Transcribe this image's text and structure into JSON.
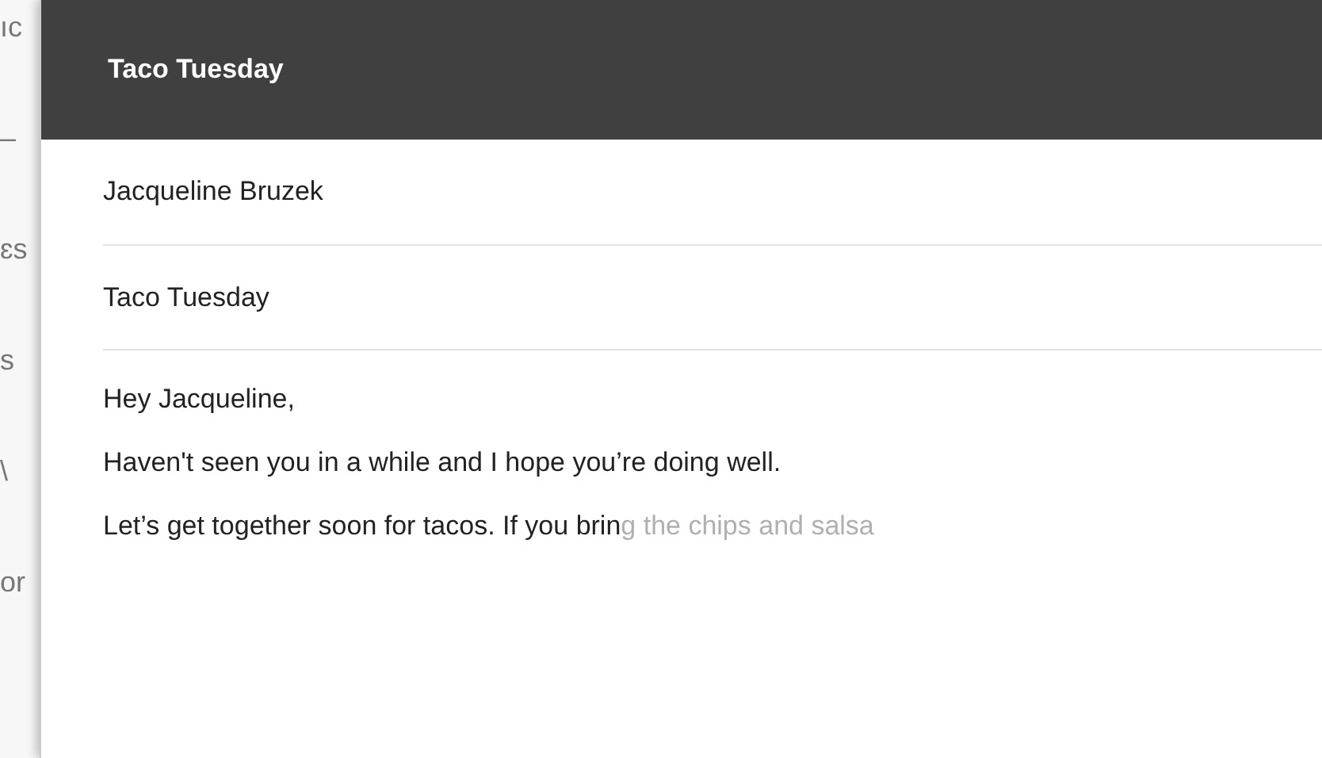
{
  "background_fragments": [
    "ıc",
    "–",
    "ɛs",
    "s",
    "\\",
    "or"
  ],
  "compose": {
    "title": "Taco Tuesday",
    "to": "Jacqueline Bruzek",
    "subject": "Taco Tuesday",
    "body": [
      {
        "kind": "line",
        "text": "Hey Jacqueline,"
      },
      {
        "kind": "line",
        "text": "Haven't seen you in a while and I hope you’re doing well."
      },
      {
        "kind": "suggested",
        "text": "Let’s get together soon for tacos. If you brin",
        "suggestion": "g the chips and salsa"
      }
    ]
  }
}
